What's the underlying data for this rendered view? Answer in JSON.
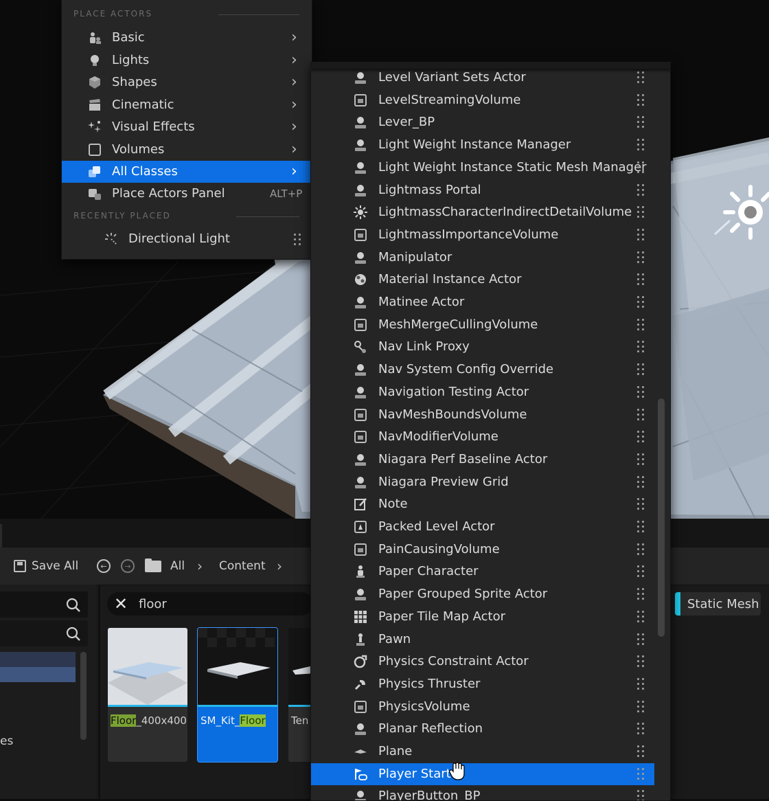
{
  "left_menu": {
    "section_place_actors": "PLACE ACTORS",
    "items": [
      {
        "label": "Basic",
        "icon": "basic-icon",
        "has_submenu": true
      },
      {
        "label": "Lights",
        "icon": "light-bulb-icon",
        "has_submenu": true
      },
      {
        "label": "Shapes",
        "icon": "shapes-icon",
        "has_submenu": true
      },
      {
        "label": "Cinematic",
        "icon": "clapper-icon",
        "has_submenu": true
      },
      {
        "label": "Visual Effects",
        "icon": "sparkles-icon",
        "has_submenu": true
      },
      {
        "label": "Volumes",
        "icon": "volume-box-icon",
        "has_submenu": true
      },
      {
        "label": "All Classes",
        "icon": "all-classes-icon",
        "has_submenu": true,
        "selected": true
      },
      {
        "label": "Place Actors Panel",
        "icon": "place-actors-icon",
        "shortcut": "ALT+P"
      }
    ],
    "section_recently_placed": "RECENTLY PLACED",
    "recent": [
      {
        "label": "Directional Light",
        "icon": "directional-light-icon"
      }
    ]
  },
  "class_list": {
    "items": [
      {
        "label": "Level Variant Sets Actor",
        "icon": "pawn-icon"
      },
      {
        "label": "LevelStreamingVolume",
        "icon": "volume-icon"
      },
      {
        "label": "Lever_BP",
        "icon": "pawn-icon"
      },
      {
        "label": "Light Weight Instance Manager",
        "icon": "pawn-icon"
      },
      {
        "label": "Light Weight Instance Static Mesh Manager",
        "icon": "pawn-icon"
      },
      {
        "label": "Lightmass Portal",
        "icon": "pawn-icon"
      },
      {
        "label": "LightmassCharacterIndirectDetailVolume",
        "icon": "sun-icon"
      },
      {
        "label": "LightmassImportanceVolume",
        "icon": "volume-icon"
      },
      {
        "label": "Manipulator",
        "icon": "pawn-icon"
      },
      {
        "label": "Material Instance Actor",
        "icon": "material-icon"
      },
      {
        "label": "Matinee Actor",
        "icon": "pawn-icon"
      },
      {
        "label": "MeshMergeCullingVolume",
        "icon": "volume-icon"
      },
      {
        "label": "Nav Link Proxy",
        "icon": "nav-link-icon"
      },
      {
        "label": "Nav System Config Override",
        "icon": "pawn-icon"
      },
      {
        "label": "Navigation Testing Actor",
        "icon": "pawn-icon"
      },
      {
        "label": "NavMeshBoundsVolume",
        "icon": "volume-icon"
      },
      {
        "label": "NavModifierVolume",
        "icon": "volume-icon"
      },
      {
        "label": "Niagara Perf Baseline Actor",
        "icon": "pawn-icon"
      },
      {
        "label": "Niagara Preview Grid",
        "icon": "pawn-icon"
      },
      {
        "label": "Note",
        "icon": "note-icon"
      },
      {
        "label": "Packed Level Actor",
        "icon": "packed-level-icon"
      },
      {
        "label": "PainCausingVolume",
        "icon": "volume-icon"
      },
      {
        "label": "Paper Character",
        "icon": "character-icon"
      },
      {
        "label": "Paper Grouped Sprite Actor",
        "icon": "pawn-icon"
      },
      {
        "label": "Paper Tile Map Actor",
        "icon": "tile-map-icon"
      },
      {
        "label": "Pawn",
        "icon": "pawn-figure-icon"
      },
      {
        "label": "Physics Constraint Actor",
        "icon": "constraint-icon"
      },
      {
        "label": "Physics Thruster",
        "icon": "thruster-icon"
      },
      {
        "label": "PhysicsVolume",
        "icon": "volume-icon"
      },
      {
        "label": "Planar Reflection",
        "icon": "pawn-icon"
      },
      {
        "label": "Plane",
        "icon": "plane-icon"
      },
      {
        "label": "Player Start",
        "icon": "player-start-icon",
        "selected": true
      },
      {
        "label": "PlayerButton_BP",
        "icon": "pawn-icon"
      }
    ]
  },
  "content_browser": {
    "toolbar": {
      "save_all": "Save All",
      "path": [
        "All",
        "Content"
      ]
    },
    "search_value": "floor",
    "left_fragment_text": "es",
    "filter_chip": "Static Mesh",
    "assets": [
      {
        "name_highlight": "Floor",
        "name_rest": "_400x400",
        "selected": false
      },
      {
        "name_prefix": "SM_Kit_",
        "name_highlight": "Floor",
        "selected": true
      },
      {
        "name_prefix": "Ten",
        "selected": false
      }
    ]
  },
  "colors": {
    "selection": "#0d6fe3",
    "menu_bg": "#262626",
    "accent_cyan": "#1ec8e8",
    "highlight_green": "#7aa233"
  }
}
